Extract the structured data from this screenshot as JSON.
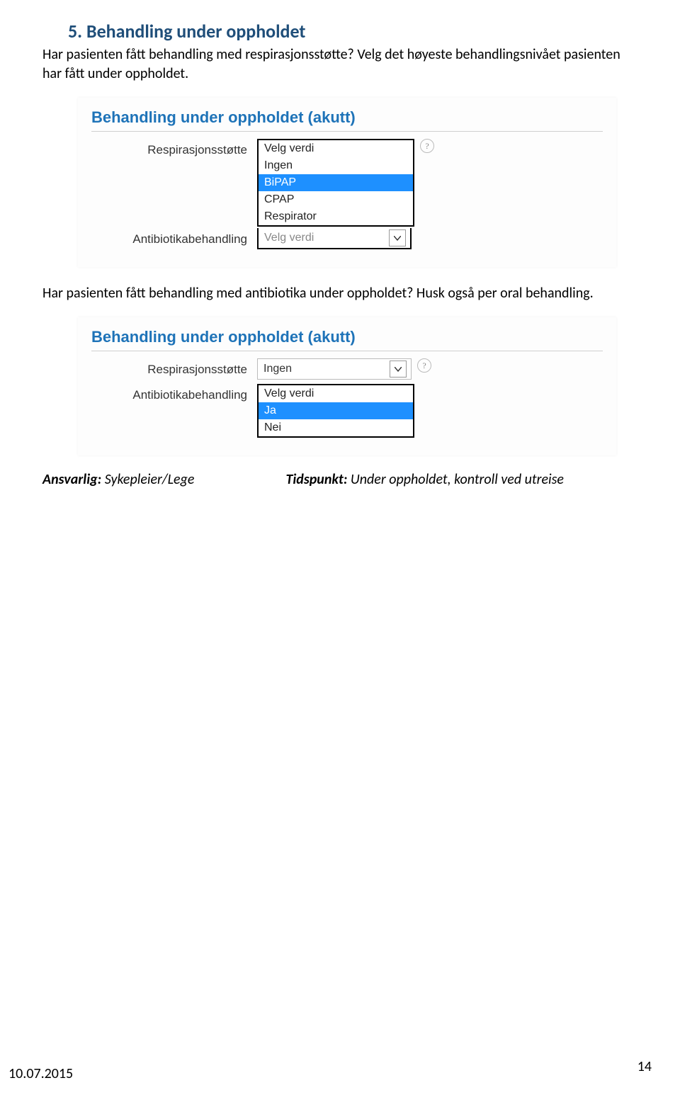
{
  "heading": "5. Behandling under oppholdet",
  "para1": "Har pasienten fått behandling med respirasjonsstøtte? Velg det høyeste behandlingsnivået pasienten har fått under oppholdet.",
  "para2": "Har pasienten fått behandling med antibiotika under oppholdet? Husk også per oral behandling.",
  "meta": {
    "ansvarlig_label": "Ansvarlig:",
    "ansvarlig_value": " Sykepleier/Lege",
    "tidspunkt_label": "Tidspunkt:",
    "tidspunkt_value": " Under oppholdet, kontroll ved utreise"
  },
  "card1": {
    "title": "Behandling under oppholdet (akutt)",
    "label_resp": "Respirasjonsstøtte",
    "label_antib": "Antibiotikabehandling",
    "resp_options": [
      "Velg verdi",
      "Ingen",
      "BiPAP",
      "CPAP",
      "Respirator"
    ],
    "resp_selected": "BiPAP",
    "antib_masked": "Velg verdi"
  },
  "card2": {
    "title": "Behandling under oppholdet (akutt)",
    "label_resp": "Respirasjonsstøtte",
    "label_antib": "Antibiotikabehandling",
    "resp_value": "Ingen",
    "antib_options": [
      "Velg verdi",
      "Ja",
      "Nei"
    ],
    "antib_selected": "Ja"
  },
  "footer": {
    "date": "10.07.2015",
    "page": "14"
  }
}
